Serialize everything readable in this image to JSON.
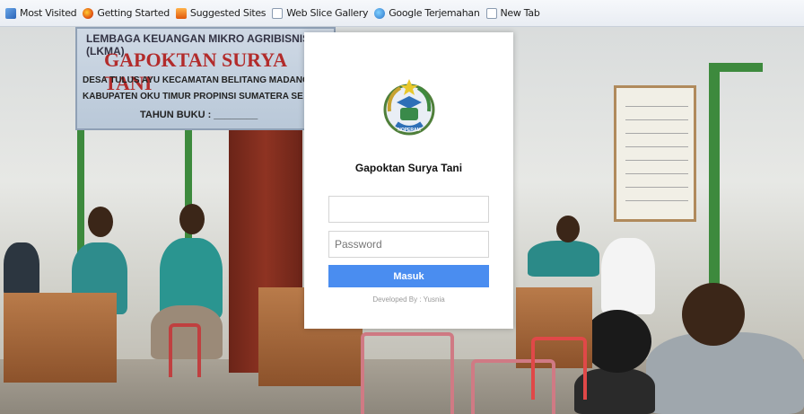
{
  "bookmarks": [
    {
      "label": "Most Visited",
      "icon": "most-visited-icon"
    },
    {
      "label": "Getting Started",
      "icon": "firefox-icon"
    },
    {
      "label": "Suggested Sites",
      "icon": "suggested-sites-icon"
    },
    {
      "label": "Web Slice Gallery",
      "icon": "page-icon"
    },
    {
      "label": "Google Terjemahan",
      "icon": "google-translate-icon"
    },
    {
      "label": "New Tab",
      "icon": "page-icon"
    }
  ],
  "background": {
    "banner": {
      "line1": "LEMBAGA KEUANGAN MIKRO AGRIBISNIS (LKMA)",
      "line2": "GAPOKTAN SURYA TANI",
      "line3": "DESA TULUS AYU KECAMATAN BELITANG MADANG",
      "line4": "KABUPATEN OKU TIMUR PROPINSI SUMATERA SE",
      "line5": "TAHUN BUKU : ________"
    }
  },
  "login": {
    "logo_text": "NOPERAM",
    "title": "Gapoktan Surya Tani",
    "username_value": "",
    "username_placeholder": "",
    "password_placeholder": "Password",
    "submit_label": "Masuk",
    "footer": "Developed By : Yusnia",
    "accent_color": "#4a8df0"
  }
}
